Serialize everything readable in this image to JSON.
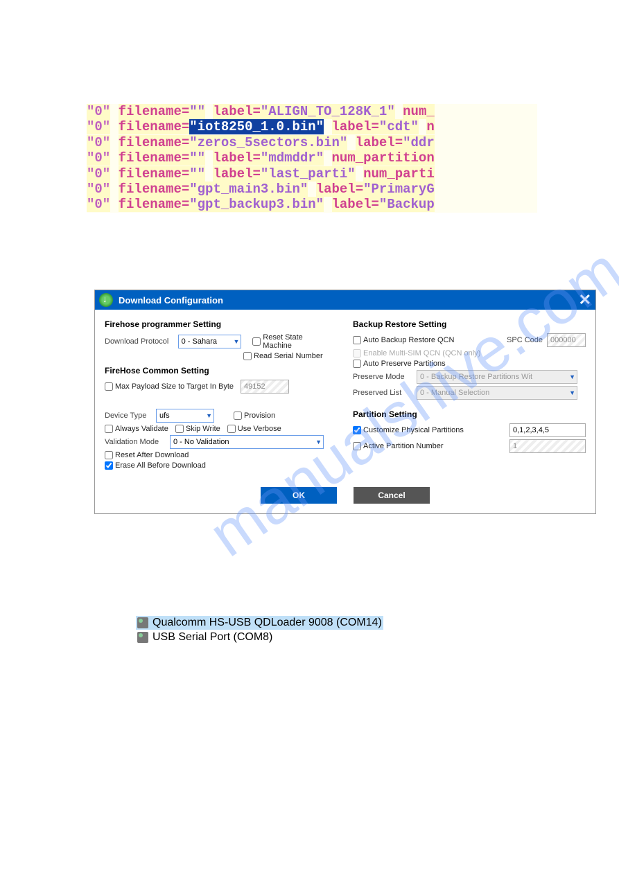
{
  "code_lines": [
    {
      "prefix": "\"0\"",
      "attr": "filename=",
      "val": "\"\"",
      "attr2": "label=",
      "val2": "\"ALIGN_TO_128K_1\"",
      "tail": "num_"
    },
    {
      "prefix": "\"0\"",
      "attr": "filename=",
      "sel": "\"iot8250_1.0.bin\"",
      "attr2": "label=",
      "val2": "\"cdt\"",
      "tail": "n"
    },
    {
      "prefix": "\"0\"",
      "attr": "filename=",
      "val": "\"zeros_5sectors.bin\"",
      "attr2": "label=",
      "val2": "\"ddr",
      "tail": ""
    },
    {
      "prefix": "\"0\"",
      "attr": "filename=",
      "val": "\"\"",
      "attr2": "label=",
      "val2": "\"mdmddr\"",
      "tail": "num_partition"
    },
    {
      "prefix": "\"0\"",
      "attr": "filename=",
      "val": "\"\"",
      "attr2": "label=",
      "val2": "\"last_parti\"",
      "tail": "num_parti"
    },
    {
      "prefix": "\"0\"",
      "attr": "filename=",
      "val": "\"gpt_main3.bin\"",
      "attr2": "label=",
      "val2": "\"PrimaryG",
      "tail": ""
    },
    {
      "prefix": "\"0\"",
      "attr": "filename=",
      "val": "\"gpt_backup3.bin\"",
      "attr2": "label=",
      "val2": "\"Backup",
      "tail": ""
    }
  ],
  "watermark": "manualshive.com",
  "dialog": {
    "title": "Download Configuration",
    "left": {
      "programmer_title": "Firehose programmer Setting",
      "download_protocol_label": "Download Protocol",
      "download_protocol_value": "0 - Sahara",
      "reset_state_machine": "Reset State Machine",
      "read_serial_number": "Read Serial Number",
      "common_title": "FireHose Common Setting",
      "max_payload_label": "Max Payload Size to Target In Byte",
      "max_payload_value": "49152",
      "device_type_label": "Device Type",
      "device_type_value": "ufs",
      "provision": "Provision",
      "always_validate": "Always Validate",
      "skip_write": "Skip Write",
      "use_verbose": "Use Verbose",
      "validation_mode_label": "Validation Mode",
      "validation_mode_value": "0 - No Validation",
      "reset_after_download": "Reset After Download",
      "erase_all": "Erase All Before Download"
    },
    "right": {
      "backup_title": "Backup Restore Setting",
      "auto_backup_restore_qcn": "Auto Backup Restore QCN",
      "spc_code_label": "SPC Code",
      "spc_code_value": "000000",
      "enable_multi_sim": "Enable Multi-SIM QCN (QCN only)",
      "auto_preserve_partitions": "Auto Preserve Partitions",
      "preserve_mode_label": "Preserve Mode",
      "preserve_mode_value": "0 - Backup Restore Partitions Wit",
      "preserved_list_label": "Preserved List",
      "preserved_list_value": "0 - Manual Selection",
      "partition_title": "Partition Setting",
      "customize_physical": "Customize Physical Partitions",
      "customize_physical_value": "0,1,2,3,4,5",
      "active_partition_number": "Active Partition Number",
      "active_partition_value": "1"
    },
    "ok": "OK",
    "cancel": "Cancel"
  },
  "devices": {
    "item1": "Qualcomm HS-USB QDLoader 9008 (COM14)",
    "item2": "USB Serial Port (COM8)"
  }
}
